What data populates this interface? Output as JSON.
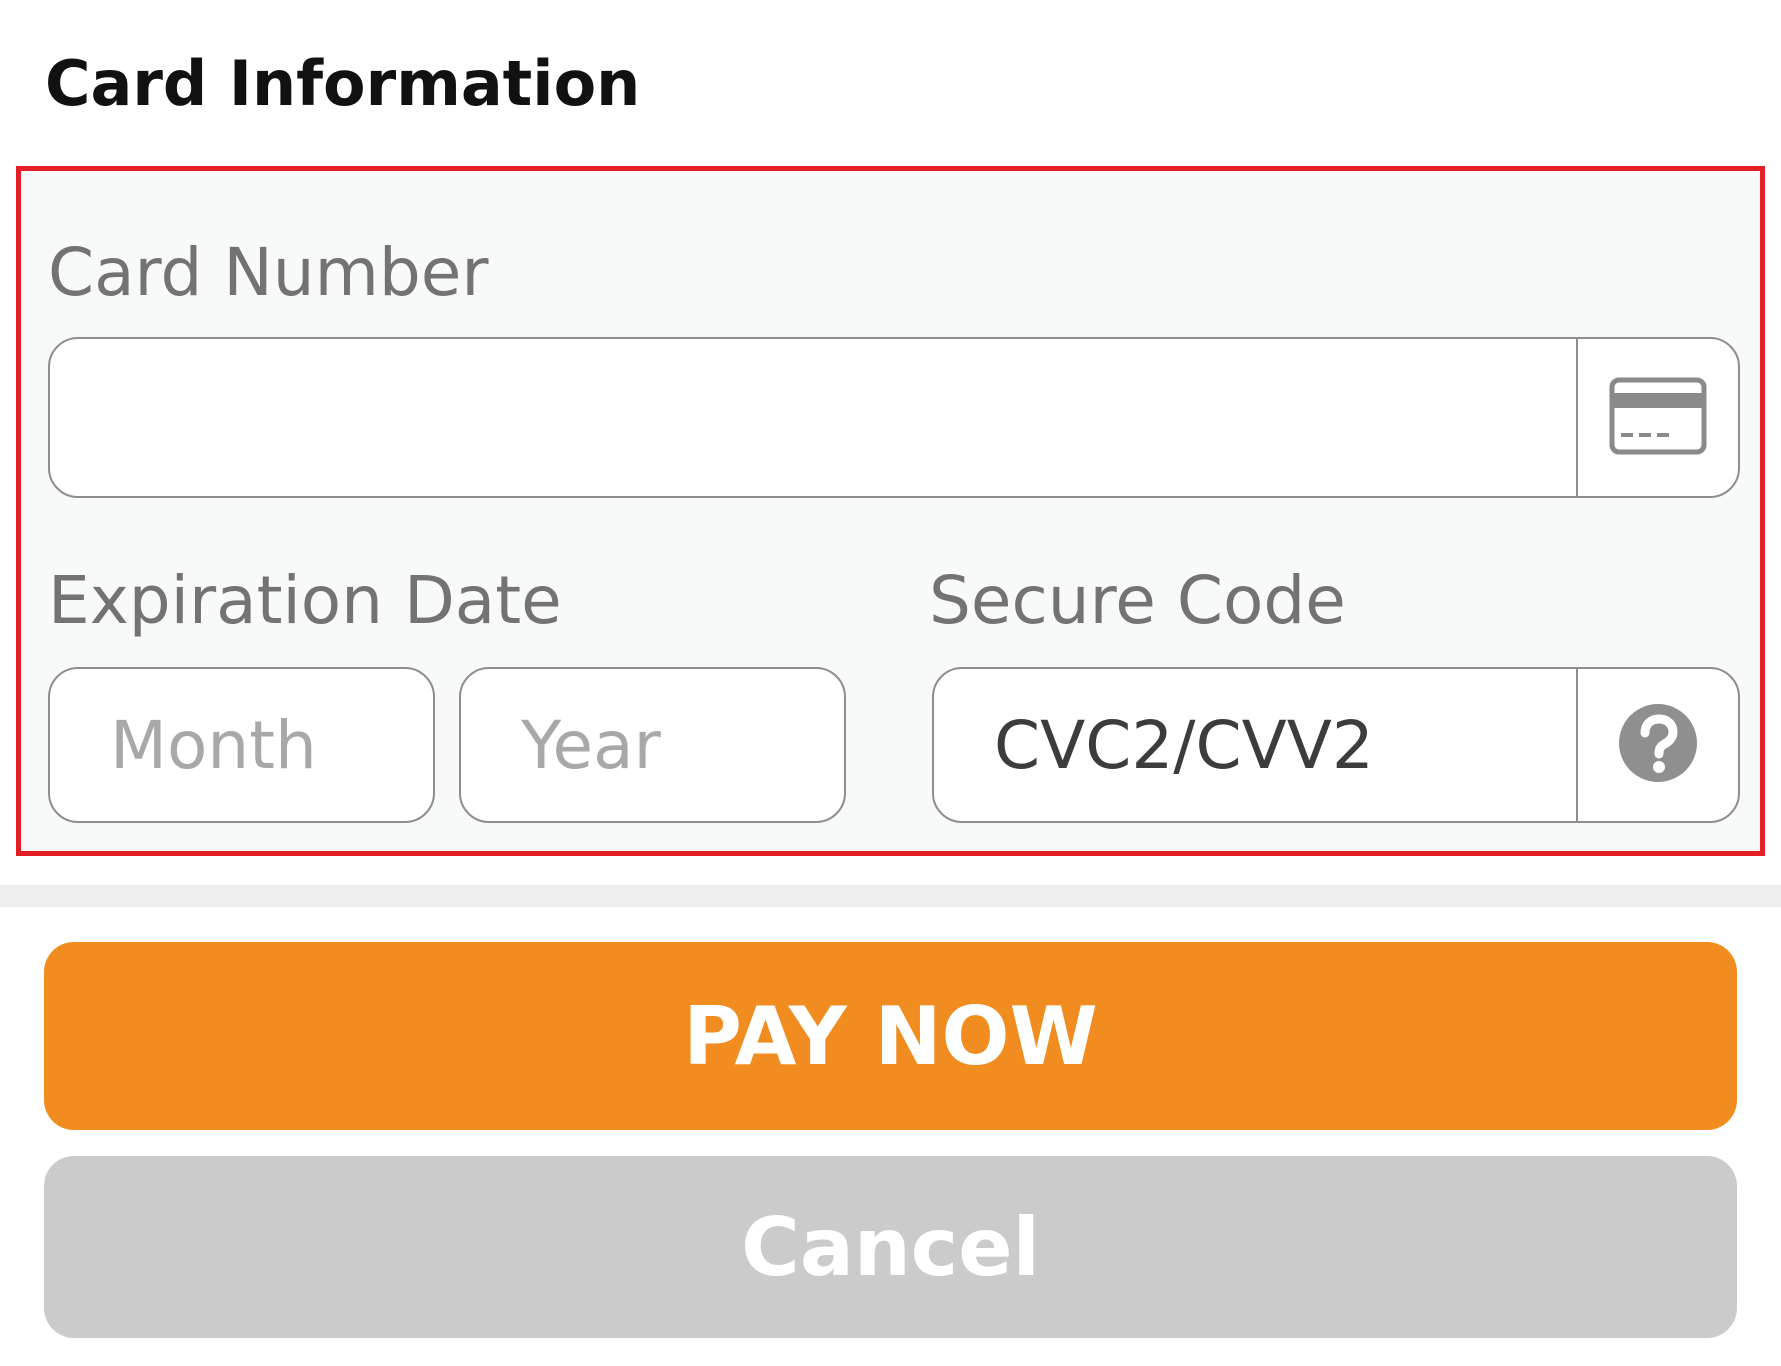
{
  "header": {
    "title": "Card Information"
  },
  "card_number": {
    "label": "Card Number",
    "value": "",
    "placeholder": "",
    "icon": "credit-card-icon"
  },
  "expiration": {
    "label": "Expiration Date",
    "month_placeholder": "Month",
    "year_placeholder": "Year"
  },
  "secure_code": {
    "label": "Secure Code",
    "value": "CVC2/CVV2",
    "icon": "help-icon"
  },
  "actions": {
    "pay_label": "PAY NOW",
    "cancel_label": "Cancel"
  },
  "colors": {
    "highlight_border": "#e31e24",
    "pay_button": "#f08c20",
    "cancel_button": "#cbcbcb"
  }
}
